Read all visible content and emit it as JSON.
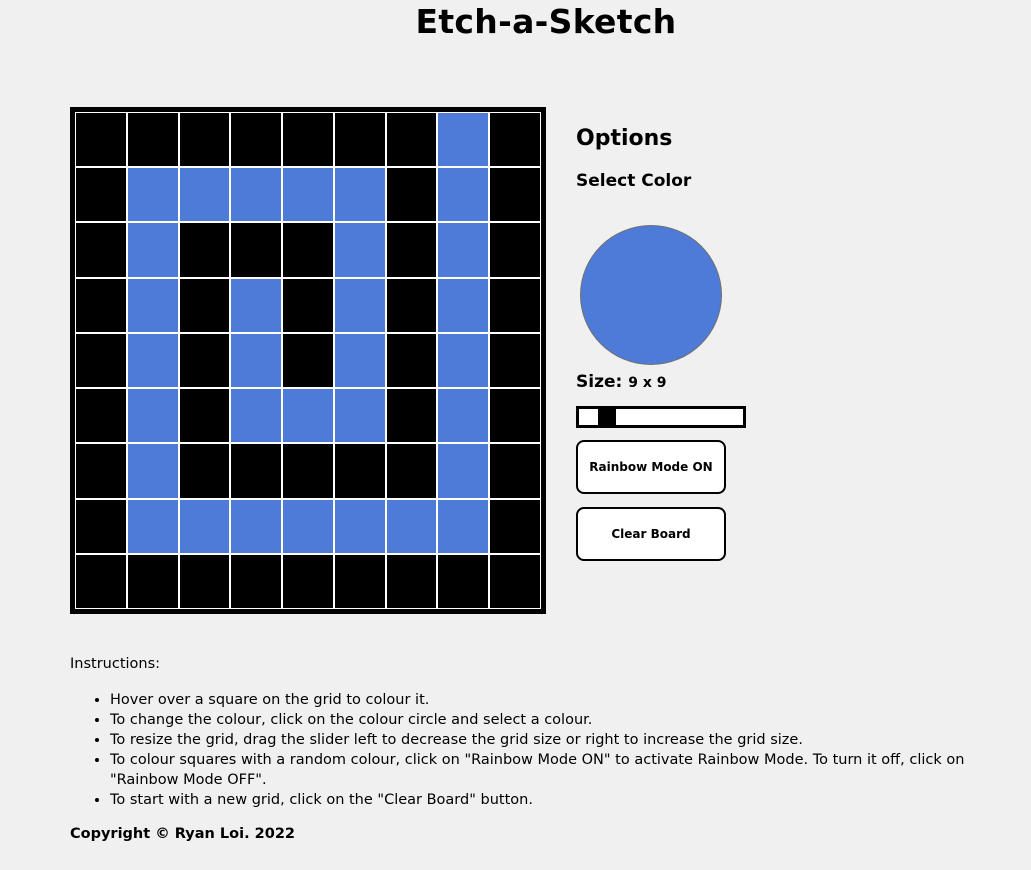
{
  "page": {
    "title": "Etch-a-Sketch"
  },
  "board": {
    "size": 9,
    "paint_color": "#4e7bd8",
    "base_color": "#000000",
    "painted_cells": [
      [
        0,
        7
      ],
      [
        1,
        1
      ],
      [
        1,
        2
      ],
      [
        1,
        3
      ],
      [
        1,
        4
      ],
      [
        1,
        5
      ],
      [
        1,
        7
      ],
      [
        2,
        1
      ],
      [
        2,
        5
      ],
      [
        2,
        7
      ],
      [
        3,
        1
      ],
      [
        3,
        3
      ],
      [
        3,
        5
      ],
      [
        3,
        7
      ],
      [
        4,
        1
      ],
      [
        4,
        3
      ],
      [
        4,
        5
      ],
      [
        4,
        7
      ],
      [
        5,
        1
      ],
      [
        5,
        3
      ],
      [
        5,
        4
      ],
      [
        5,
        5
      ],
      [
        5,
        7
      ],
      [
        6,
        1
      ],
      [
        6,
        7
      ],
      [
        7,
        1
      ],
      [
        7,
        2
      ],
      [
        7,
        3
      ],
      [
        7,
        4
      ],
      [
        7,
        5
      ],
      [
        7,
        6
      ],
      [
        7,
        7
      ]
    ]
  },
  "options": {
    "heading": "Options",
    "select_color_label": "Select Color",
    "selected_color": "#4e7bd8",
    "size_label": "Size:",
    "size_value": "9 x 9",
    "slider_value": 9,
    "rainbow_button_label": "Rainbow Mode ON",
    "clear_button_label": "Clear Board"
  },
  "instructions": {
    "title": "Instructions:",
    "items": [
      "Hover over a square on the grid to colour it.",
      "To change the colour, click on the colour circle and select a colour.",
      "To resize the grid, drag the slider left to decrease the grid size or right to increase the grid size.",
      "To colour squares with a random colour, click on \"Rainbow Mode ON\" to activate Rainbow Mode. To turn it off, click on \"Rainbow Mode OFF\".",
      "To start with a new grid, click on the \"Clear Board\" button."
    ]
  },
  "footer": {
    "copyright": "Copyright © Ryan Loi. 2022"
  }
}
